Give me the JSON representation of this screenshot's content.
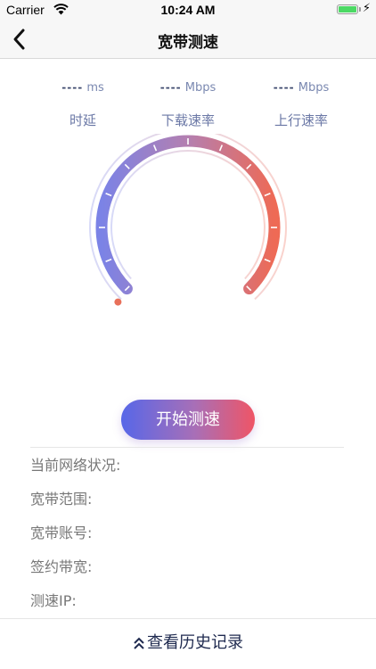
{
  "status_bar": {
    "carrier": "Carrier",
    "time": "10:24 AM",
    "battery_level": 1.0,
    "battery_color": "#4cd964"
  },
  "nav": {
    "title": "宽带测速",
    "back_icon": "chevron-left-icon"
  },
  "stats": [
    {
      "value": "----",
      "unit": "ms",
      "label": "时延"
    },
    {
      "value": "----",
      "unit": "Mbps",
      "label": "下载速率"
    },
    {
      "value": "----",
      "unit": "Mbps",
      "label": "上行速率"
    }
  ],
  "gauge": {
    "value": 0,
    "gradient_start": "#7b83e6",
    "gradient_mid": "#b47fb0",
    "gradient_end": "#ee6a55",
    "indicator_color": "#e8705a"
  },
  "start_button": {
    "label": "开始测速"
  },
  "info": {
    "network_status": "当前网络状况:",
    "range": "宽带范围:",
    "account": "宽带账号:",
    "bandwidth": "签约带宽:",
    "ip": "测速IP:"
  },
  "footer": {
    "label": "查看历史记录",
    "icon": "double-chevron-up-icon"
  }
}
